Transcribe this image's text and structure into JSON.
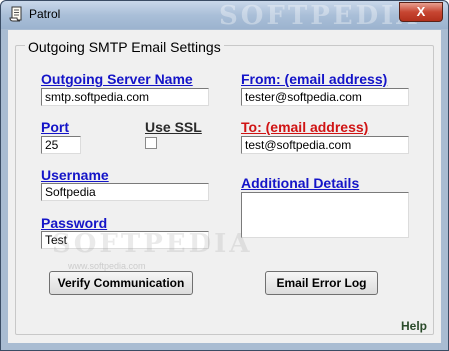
{
  "window": {
    "title": "Patrol",
    "close_symbol": "X",
    "watermark_top": "SOFTPEDIA"
  },
  "group": {
    "title": "Outgoing SMTP Email Settings"
  },
  "fields": {
    "outgoing_server": {
      "label": "Outgoing Server Name",
      "value": "smtp.softpedia.com"
    },
    "from": {
      "label": "From: (email address)",
      "value": "tester@softpedia.com"
    },
    "port": {
      "label": "Port",
      "value": "25"
    },
    "use_ssl": {
      "label": "Use SSL",
      "checked": false
    },
    "to": {
      "label": "To: (email address)",
      "value": "test@softpedia.com"
    },
    "username": {
      "label": "Username",
      "value": "Softpedia"
    },
    "additional_details": {
      "label": "Additional Details",
      "value": ""
    },
    "password": {
      "label": "Password",
      "value": "Test"
    }
  },
  "buttons": {
    "verify": "Verify Communication",
    "error_log": "Email Error Log"
  },
  "help_label": "Help",
  "watermark": {
    "main": "SOFTPEDIA",
    "sub": "www.softpedia.com"
  },
  "colors": {
    "link_blue": "#1414c8",
    "to_red": "#d01414",
    "title_bar": "#aabfd8",
    "close_red": "#c74632"
  },
  "icons": {
    "app": "scroll-document-icon",
    "close": "close-icon"
  }
}
